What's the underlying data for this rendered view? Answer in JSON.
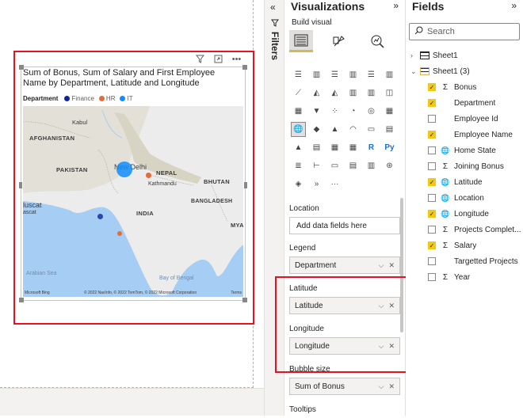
{
  "visual": {
    "title": "Sum of Bonus, Sum of Salary and First Employee Name by Department, Latitude and Longitude",
    "legend_title": "Department",
    "legend_items": [
      {
        "label": "Finance",
        "color": "#12239e"
      },
      {
        "label": "HR",
        "color": "#e66c37"
      },
      {
        "label": "IT",
        "color": "#118dff"
      }
    ],
    "map_labels": {
      "kabul": "Kabul",
      "afghanistan": "AFGHANISTAN",
      "pakistan": "PAKISTAN",
      "new_delhi": "New Delhi",
      "nepal": "NEPAL",
      "kathmandu": "Kathmandu",
      "bhutan": "BHUTAN",
      "muscat": "luscat",
      "muscat2": "ascat",
      "india": "INDIA",
      "bangladesh": "BANGLADESH",
      "mya": "MYA",
      "arabian_sea": "Arabian Sea",
      "bay_of_bengal": "Bay of Bengal"
    },
    "map_credit": "© 2022 NavInfo, © 2022 TomTom, © 2022 Microsoft Corporation",
    "map_terms": "Terms",
    "map_brand": "Microsoft Bing"
  },
  "filters": {
    "label": "Filters"
  },
  "visualizations": {
    "title": "Visualizations",
    "build_label": "Build visual",
    "location_label": "Location",
    "location_placeholder": "Add data fields here",
    "legend_label": "Legend",
    "legend_value": "Department",
    "latitude_label": "Latitude",
    "latitude_value": "Latitude",
    "longitude_label": "Longitude",
    "longitude_value": "Longitude",
    "bubble_label": "Bubble size",
    "bubble_value": "Sum of Bonus",
    "tooltips_label": "Tooltips"
  },
  "fields": {
    "title": "Fields",
    "search_placeholder": "Search",
    "tables": [
      {
        "name": "Sheet1",
        "expanded": false
      },
      {
        "name": "Sheet1 (3)",
        "expanded": true
      }
    ],
    "items": [
      {
        "name": "Bonus",
        "checked": true,
        "type": "sigma"
      },
      {
        "name": "Department",
        "checked": true,
        "type": "none"
      },
      {
        "name": "Employee Id",
        "checked": false,
        "type": "none"
      },
      {
        "name": "Employee Name",
        "checked": true,
        "type": "none"
      },
      {
        "name": "Home State",
        "checked": false,
        "type": "globe"
      },
      {
        "name": "Joining Bonus",
        "checked": false,
        "type": "sigma"
      },
      {
        "name": "Latitude",
        "checked": true,
        "type": "globe"
      },
      {
        "name": "Location",
        "checked": false,
        "type": "globe"
      },
      {
        "name": "Longitude",
        "checked": true,
        "type": "globe"
      },
      {
        "name": "Projects Complet...",
        "checked": false,
        "type": "sigma"
      },
      {
        "name": "Salary",
        "checked": true,
        "type": "sigma"
      },
      {
        "name": "Targetted Projects",
        "checked": false,
        "type": "none"
      },
      {
        "name": "Year",
        "checked": false,
        "type": "sigma"
      }
    ]
  }
}
